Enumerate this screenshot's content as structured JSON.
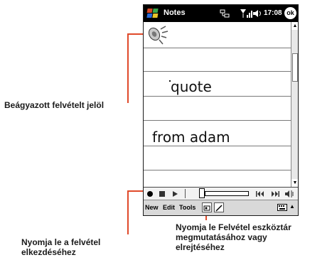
{
  "screen": {
    "app_title": "Notes",
    "clock": "17:08",
    "ok_label": "ok",
    "icons": [
      "windows-start-icon",
      "connection-icon",
      "signal-icon",
      "volume-icon"
    ]
  },
  "note": {
    "ink_lines": [
      "quote",
      "from adam"
    ],
    "embedded_recording_icon": "speaker-icon"
  },
  "recording_toolbar": {
    "buttons": [
      "record-icon",
      "stop-icon",
      "play-icon",
      "volume-slider",
      "skip-back-icon",
      "skip-forward-icon",
      "speaker-volume-icon"
    ]
  },
  "menubar": {
    "items": [
      "New",
      "Edit",
      "Tools"
    ],
    "icons": [
      "recording-toolbar-toggle-icon",
      "pen-icon",
      "keyboard-icon"
    ]
  },
  "annotations": {
    "embedded_label": "Beágyazott felvételt jelöl",
    "record_label_line1": "Nyomja le a felvétel",
    "record_label_line2": "elkezdéséhez",
    "toolbar_label_line1": "Nyomja le Felvétel eszköztár",
    "toolbar_label_line2": "megmutatásához vagy",
    "toolbar_label_line3": "elrejtéséhez"
  },
  "colors": {
    "callout": "#e04a2a",
    "titlebar": "#000000"
  }
}
